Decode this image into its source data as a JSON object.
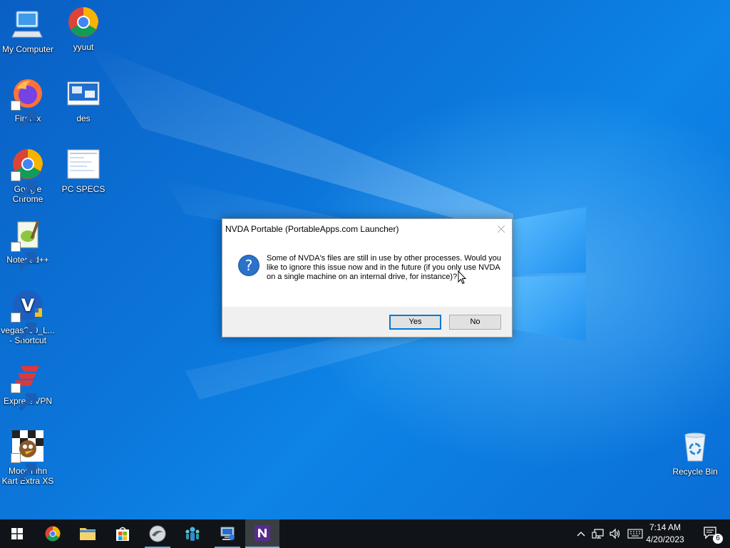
{
  "desktop": {
    "icons": [
      {
        "label": "My Computer"
      },
      {
        "label": "yyuut"
      },
      {
        "label": "Firefox"
      },
      {
        "label": "des"
      },
      {
        "label": "Google Chrome"
      },
      {
        "label": "PC SPECS"
      },
      {
        "label": "Notepad++"
      },
      {
        "label": "vegas200_L... - Shortcut"
      },
      {
        "label": "ExpressVPN"
      },
      {
        "label": "Moorhuhn Kart Extra XS"
      },
      {
        "label": "Recycle Bin"
      }
    ]
  },
  "dialog": {
    "title": "NVDA Portable (PortableApps.com Launcher)",
    "message": "Some of NVDA's files are still in use by other processes. Would you like to ignore this issue now and in the future (if you only use NVDA on a single machine on an internal drive, for instance)?",
    "yes_label": "Yes",
    "no_label": "No",
    "icon": "question-icon"
  },
  "taskbar": {
    "items": [
      {
        "name": "start-button",
        "icon": "windows-logo-icon"
      },
      {
        "name": "chrome",
        "icon": "chrome-icon"
      },
      {
        "name": "file-explorer",
        "icon": "folder-icon"
      },
      {
        "name": "microsoft-store",
        "icon": "store-icon"
      },
      {
        "name": "app-round",
        "icon": "round-app-icon"
      },
      {
        "name": "app-people",
        "icon": "people-icon"
      },
      {
        "name": "app-computer",
        "icon": "computer-icon"
      },
      {
        "name": "nvda",
        "icon": "nvda-icon"
      }
    ],
    "clock": {
      "time": "7:14 AM",
      "date": "4/20/2023"
    },
    "notifications_count": "6"
  },
  "colors": {
    "desktop_blue": "#0b6fd6",
    "taskbar": "#101418",
    "accent": "#0078d7",
    "dialog_footer": "#f0f0f0"
  }
}
